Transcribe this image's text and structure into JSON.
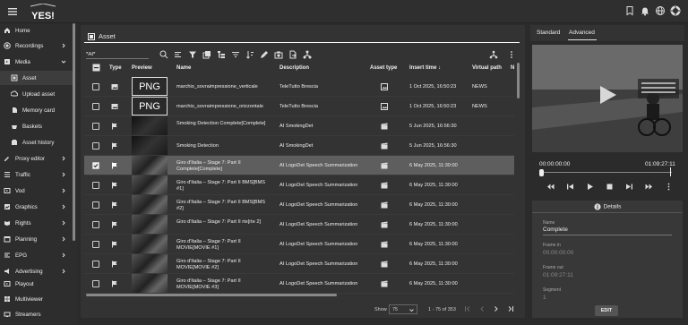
{
  "app": {
    "logo_text": "YES!"
  },
  "sidebar": {
    "items": [
      {
        "label": "Home",
        "icon": "home-icon",
        "chevron": false
      },
      {
        "label": "Recordings",
        "icon": "recordings-icon",
        "chevron": true
      },
      {
        "label": "Media",
        "icon": "media-icon",
        "chevron": true,
        "expanded": true
      },
      {
        "label": "Asset",
        "icon": "asset-icon",
        "sub": true,
        "active": true
      },
      {
        "label": "Upload asset",
        "icon": "upload-icon",
        "sub": true
      },
      {
        "label": "Memory card",
        "icon": "memory-card-icon",
        "sub": true
      },
      {
        "label": "Baskets",
        "icon": "basket-icon",
        "sub": true
      },
      {
        "label": "Asset history",
        "icon": "history-icon",
        "sub": true
      },
      {
        "label": "Proxy editor",
        "icon": "proxy-editor-icon",
        "chevron": true
      },
      {
        "label": "Traffic",
        "icon": "traffic-icon",
        "chevron": true
      },
      {
        "label": "Vod",
        "icon": "vod-icon",
        "chevron": true
      },
      {
        "label": "Graphics",
        "icon": "graphics-icon",
        "chevron": true
      },
      {
        "label": "Rights",
        "icon": "rights-icon",
        "chevron": true
      },
      {
        "label": "Planning",
        "icon": "planning-icon",
        "chevron": true
      },
      {
        "label": "EPG",
        "icon": "epg-icon",
        "chevron": true
      },
      {
        "label": "Advertising",
        "icon": "advertising-icon",
        "chevron": true
      },
      {
        "label": "Playout",
        "icon": "playout-icon",
        "chevron": false
      },
      {
        "label": "Multiviewer",
        "icon": "multiviewer-icon",
        "chevron": false
      },
      {
        "label": "Streamers",
        "icon": "streamers-icon",
        "chevron": false
      }
    ]
  },
  "main": {
    "title": "Asset",
    "filter_value": "*AI*",
    "columns": {
      "type": "Type",
      "preview": "Preview",
      "name": "Name",
      "description": "Description",
      "asset_type": "Asset type",
      "insert_time": "Insert time ↓",
      "virtual_path": "Virtual path",
      "extra": "N"
    },
    "rows": [
      {
        "type": "image",
        "preview": "png",
        "preview_text": "PNG",
        "name": "marchio_sovraimpressione_verticale",
        "description": "TeleTutto Brescia",
        "asset_type": "image",
        "insert_time": "1 Oct 2025, 16:50:23",
        "virtual_path": "NEWS",
        "selected": false
      },
      {
        "type": "image",
        "preview": "png",
        "preview_text": "PNG",
        "name": "marchio_sovraimpressione_orizzontale",
        "description": "TeleTutto Brescia",
        "asset_type": "image",
        "insert_time": "1 Oct 2025, 16:50:23",
        "virtual_path": "NEWS",
        "selected": false
      },
      {
        "type": "flag",
        "preview": "dark",
        "name": "Smoking Detection Complete[Complete]",
        "description": "AI SmokingDet",
        "asset_type": "video",
        "insert_time": "5 Jun 2025, 16:56:30",
        "virtual_path": "",
        "selected": false
      },
      {
        "type": "flag",
        "preview": "dark",
        "name": "Smoking Detection",
        "description": "AI SmokingDet",
        "asset_type": "video",
        "insert_time": "5 Jun 2025, 16:56:30",
        "virtual_path": "",
        "selected": false
      },
      {
        "type": "flag",
        "preview": "thumb",
        "name": "Giro d'Italia – Stage 7: Part II Complete[Complete]",
        "description": "AI LogoDet Speech Summarization",
        "asset_type": "video",
        "insert_time": "6 May 2025, 11:30:00",
        "virtual_path": "",
        "selected": true
      },
      {
        "type": "flag",
        "preview": "thumb",
        "name": "Giro d'Italia – Stage 7: Part II BMS[BMS #1]",
        "description": "AI LogoDet Speech Summarization",
        "asset_type": "video",
        "insert_time": "6 May 2025, 11:30:00",
        "virtual_path": "",
        "selected": false
      },
      {
        "type": "flag",
        "preview": "thumb",
        "name": "Giro d'Italia – Stage 7: Part II BMS[BMS #2]",
        "description": "AI LogoDet Speech Summarization",
        "asset_type": "video",
        "insert_time": "6 May 2025, 11:30:00",
        "virtual_path": "",
        "selected": false
      },
      {
        "type": "flag",
        "preview": "thumb",
        "name": "Giro d'Italia – Stage 7: Part II rte[rte 2]",
        "description": "AI LogoDet Speech Summarization",
        "asset_type": "video",
        "insert_time": "6 May 2025, 11:30:00",
        "virtual_path": "",
        "selected": false
      },
      {
        "type": "flag",
        "preview": "thumb",
        "name": "Giro d'Italia – Stage 7: Part II MOVIE[MOVIE #1]",
        "description": "AI LogoDet Speech Summarization",
        "asset_type": "video",
        "insert_time": "6 May 2025, 11:30:00",
        "virtual_path": "",
        "selected": false
      },
      {
        "type": "flag",
        "preview": "thumb",
        "name": "Giro d'Italia – Stage 7: Part II MOVIE[MOVIE #2]",
        "description": "AI LogoDet Speech Summarization",
        "asset_type": "video",
        "insert_time": "6 May 2025, 11:30:00",
        "virtual_path": "",
        "selected": false
      },
      {
        "type": "flag",
        "preview": "thumb",
        "name": "Giro d'Italia – Stage 7: Part II MOVIE[MOVIE #3]",
        "description": "AI LogoDet Speech Summarization",
        "asset_type": "video",
        "insert_time": "6 May 2025, 11:30:00",
        "virtual_path": "",
        "selected": false
      }
    ],
    "pagination": {
      "show_label": "Show",
      "page_size": "75",
      "range": "1 - 75 of 353"
    }
  },
  "right": {
    "tabs": [
      "Standard",
      "Advanced"
    ],
    "active_tab": "Advanced",
    "player": {
      "current_time": "00:00:00:00",
      "duration": "01:09:27:11"
    },
    "details": {
      "title": "Details",
      "name_label": "Name",
      "name_value": "Complete",
      "frame_in_label": "Frame in",
      "frame_in_value": "00:00:00:00",
      "frame_out_label": "Frame out",
      "frame_out_value": "01:09:27:11",
      "segment_label": "Segment",
      "segment_value": "1",
      "edit_label": "EDIT"
    }
  }
}
